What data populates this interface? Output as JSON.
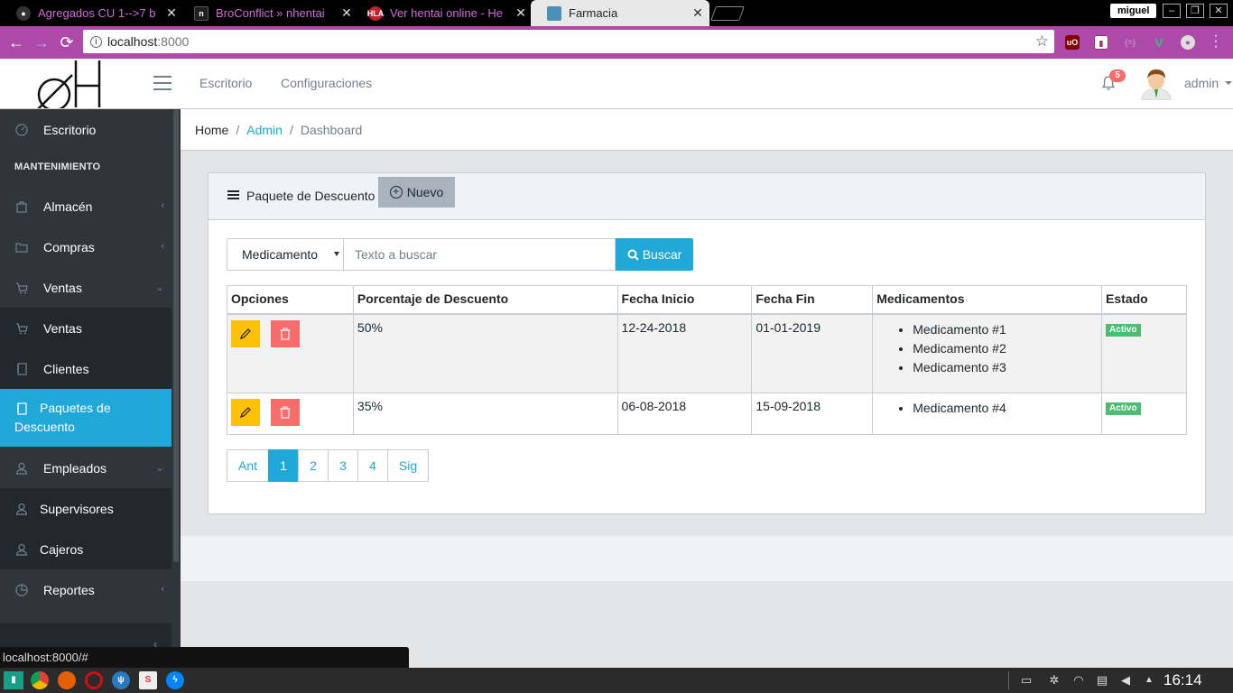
{
  "browser": {
    "tabs": [
      {
        "title": "Agregados CU 1-->7 b",
        "close": "✕"
      },
      {
        "title": "BroConflict » nhentai",
        "close": "✕"
      },
      {
        "title": "Ver hentai online - He",
        "close": "✕"
      },
      {
        "title": "Farmacia",
        "close": "✕"
      }
    ],
    "profile": "miguel",
    "url_host": "localhost",
    "url_port": ":8000",
    "status_url": "localhost:8000/#"
  },
  "header": {
    "nav": [
      "Escritorio",
      "Configuraciones"
    ],
    "notifications": "5",
    "user": "admin"
  },
  "sidebar": {
    "section_title": "MANTENIMIENTO",
    "items": [
      {
        "label": "Escritorio",
        "icon": "speedometer-icon"
      },
      {
        "label": "Almacén",
        "icon": "bag-icon"
      },
      {
        "label": "Compras",
        "icon": "folder-icon"
      },
      {
        "label": "Ventas",
        "icon": "cart-icon"
      },
      {
        "label": "Ventas",
        "icon": "cart-icon"
      },
      {
        "label": "Clientes",
        "icon": "notebook-icon"
      },
      {
        "label": "Paquetes de Descuento",
        "icon": "notebook-icon"
      },
      {
        "label": "Empleados",
        "icon": "user-icon"
      },
      {
        "label": "Supervisores",
        "icon": "user-icon"
      },
      {
        "label": "Cajeros",
        "icon": "user-icon"
      },
      {
        "label": "Reportes",
        "icon": "pie-chart-icon"
      }
    ]
  },
  "breadcrumb": {
    "home": "Home",
    "sep": "/",
    "admin": "Admin",
    "current": "Dashboard"
  },
  "card": {
    "title": "Paquete de Descuento",
    "new_button": "Nuevo"
  },
  "search": {
    "selected": "Medicamento",
    "placeholder": "Texto a buscar",
    "button": "Buscar"
  },
  "table": {
    "headers": [
      "Opciones",
      "Porcentaje de Descuento",
      "Fecha Inicio",
      "Fecha Fin",
      "Medicamentos",
      "Estado"
    ],
    "rows": [
      {
        "percent": "50%",
        "start": "12-24-2018",
        "end": "01-01-2019",
        "meds": [
          "Medicamento #1",
          "Medicamento #2",
          "Medicamento #3"
        ],
        "status": "Activo"
      },
      {
        "percent": "35%",
        "start": "06-08-2018",
        "end": "15-09-2018",
        "meds": [
          "Medicamento #4"
        ],
        "status": "Activo"
      }
    ]
  },
  "pagination": [
    "Ant",
    "1",
    "2",
    "3",
    "4",
    "Sig"
  ],
  "pagination_current": "1",
  "taskbar": {
    "clock": "16:14"
  },
  "colors": {
    "primary": "#20a8d8",
    "sidebar": "#2f353a",
    "warning": "#ffc107",
    "danger": "#f86c6b",
    "success": "#4dbd74",
    "browser_toolbar": "#ad49a9"
  }
}
